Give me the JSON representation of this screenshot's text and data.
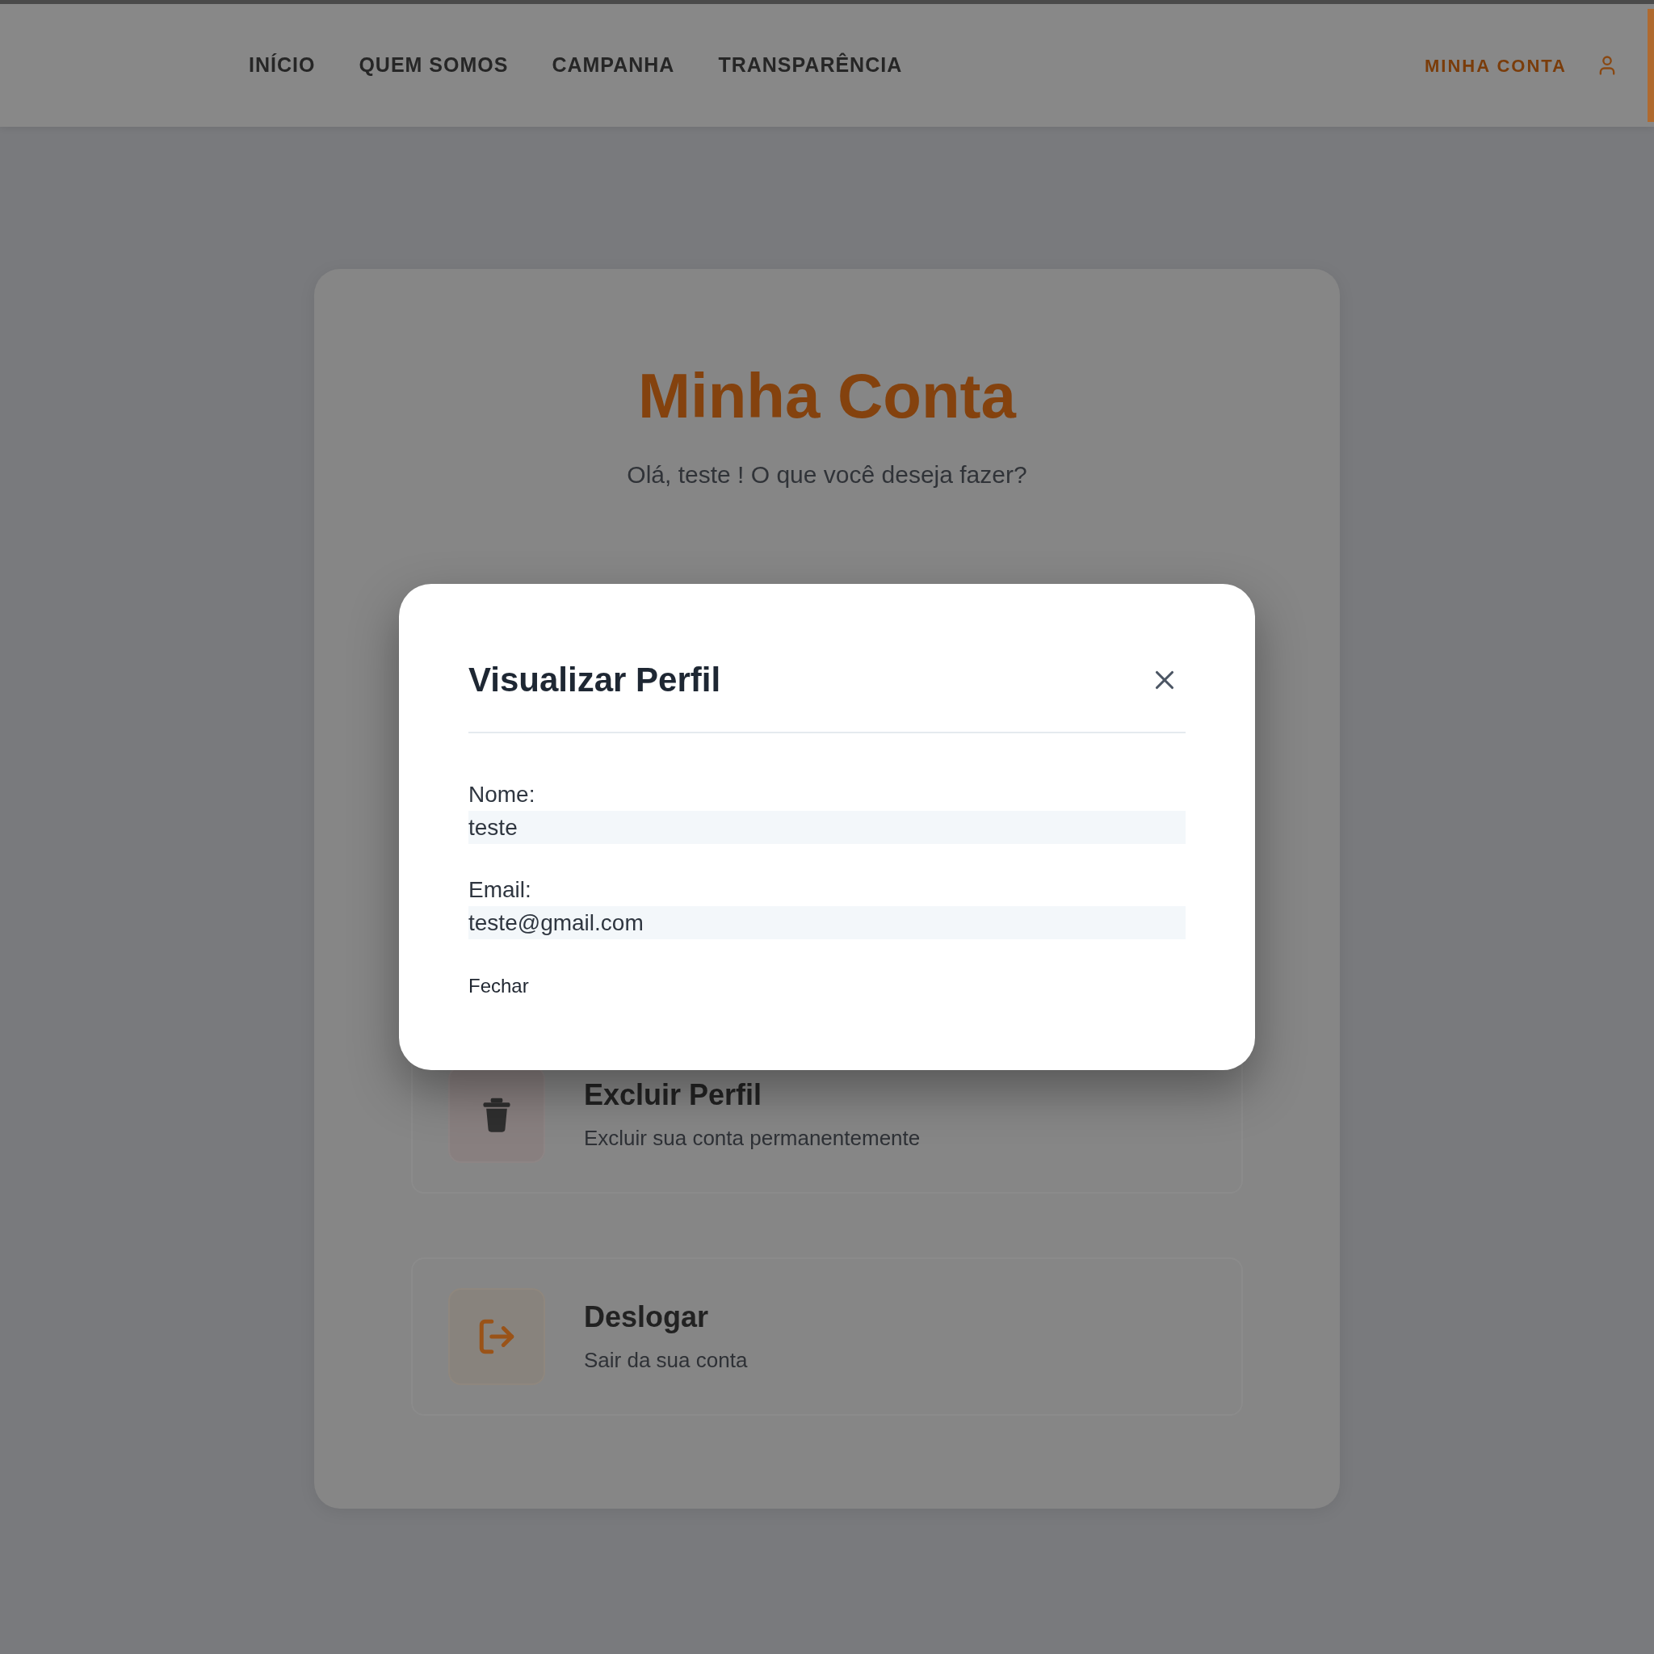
{
  "nav": {
    "links": [
      {
        "label": "INÍCIO"
      },
      {
        "label": "QUEM SOMOS"
      },
      {
        "label": "CAMPANHA"
      },
      {
        "label": "TRANSPARÊNCIA"
      }
    ],
    "account_link": {
      "label": "MINHA CONTA"
    }
  },
  "account_page": {
    "title": "Minha Conta",
    "greeting": "Olá, teste ! O que você deseja fazer?",
    "options": [
      {
        "kind": "delete",
        "title": "Excluir Perfil",
        "description": "Excluir sua conta permanentemente"
      },
      {
        "kind": "logout",
        "title": "Deslogar",
        "description": "Sair da sua conta"
      }
    ]
  },
  "dialog": {
    "title": "Visualizar Perfil",
    "fields": [
      {
        "label": "Nome:",
        "value": "teste"
      },
      {
        "label": "Email:",
        "value": "teste@gmail.com"
      }
    ],
    "close_button": "Fechar"
  }
}
